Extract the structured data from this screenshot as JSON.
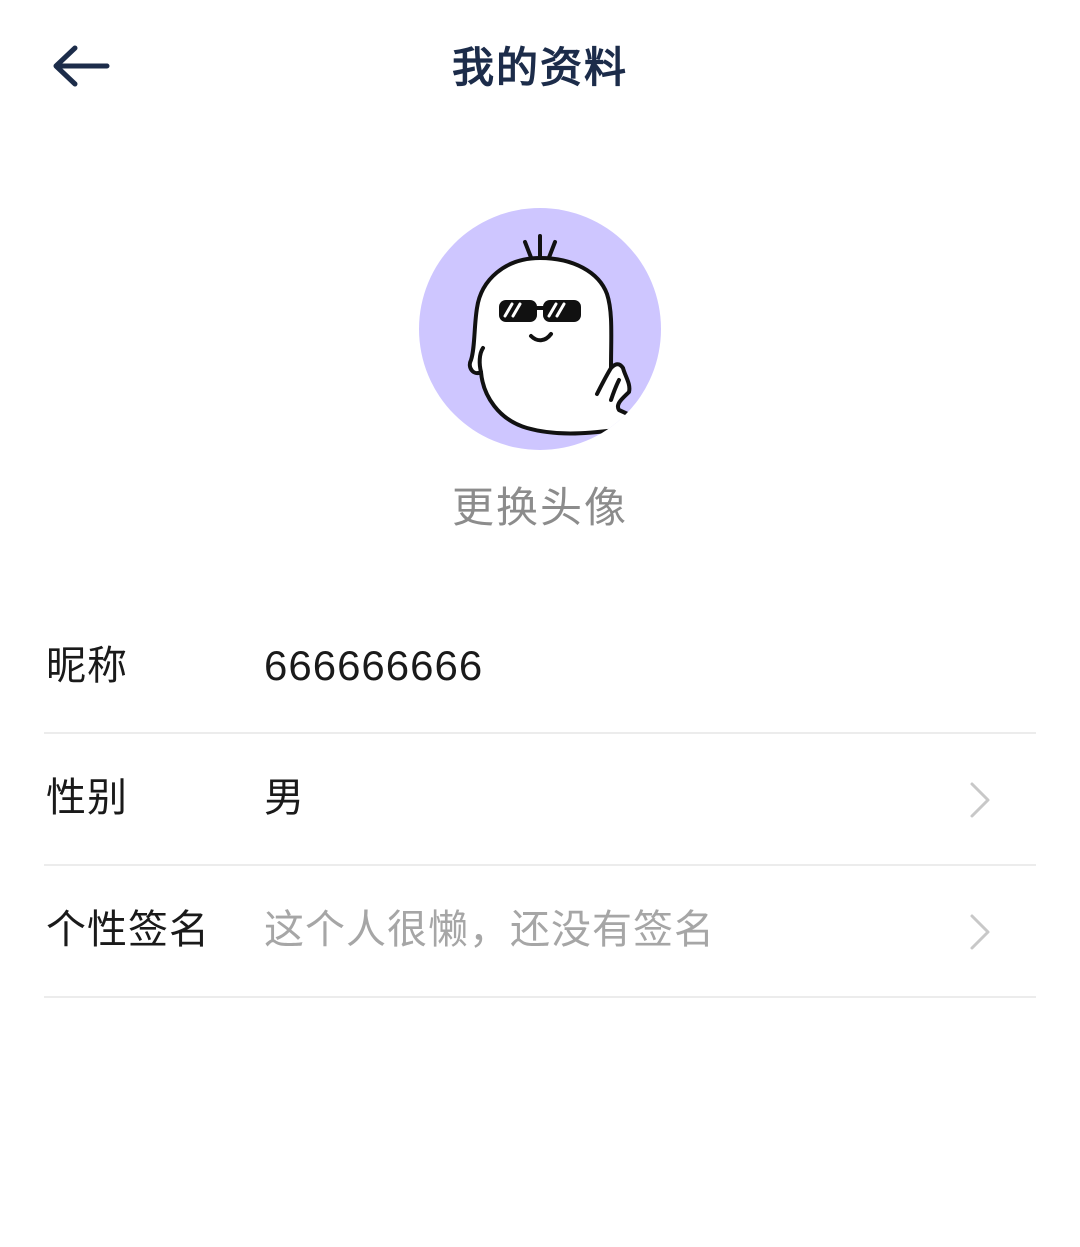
{
  "header": {
    "title": "我的资料",
    "back_icon": "arrow-left-icon"
  },
  "avatar": {
    "icon": "sunglasses-ghost-avatar",
    "background": "#cec6ff",
    "change_label": "更换头像"
  },
  "fields": [
    {
      "label": "昵称",
      "value": "666666666",
      "has_chevron": false
    },
    {
      "label": "性别",
      "value": "男",
      "has_chevron": true
    },
    {
      "label": "个性签名",
      "value": "这个人很懒，还没有签名",
      "has_chevron": true,
      "is_placeholder": true
    }
  ],
  "colors": {
    "title": "#1c2c4a",
    "muted_text": "#8c8c8c",
    "divider": "#ececec",
    "chevron": "#c8c8c8"
  }
}
